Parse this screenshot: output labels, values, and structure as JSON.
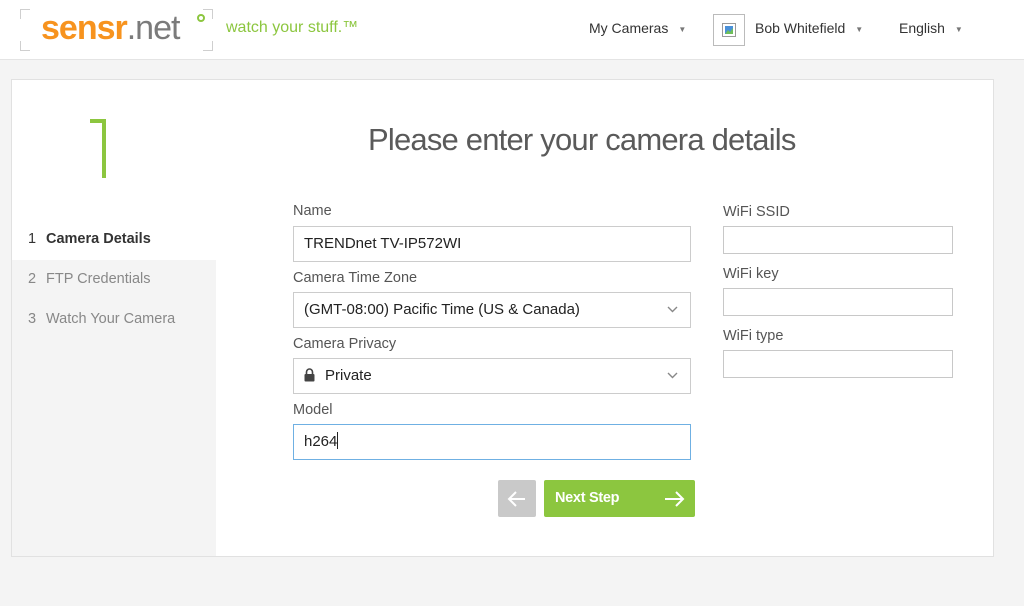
{
  "header": {
    "logo_main": "sensr",
    "logo_suffix": ".net",
    "tagline": "watch your stuff.™",
    "nav": {
      "my_cameras": "My Cameras",
      "user_name": "Bob Whitefield",
      "language": "English"
    }
  },
  "sidebar": {
    "big_step": "1",
    "steps": [
      {
        "num": "1",
        "label": "Camera Details"
      },
      {
        "num": "2",
        "label": "FTP Credentials"
      },
      {
        "num": "3",
        "label": "Watch Your Camera"
      }
    ]
  },
  "form": {
    "title": "Please enter your camera details",
    "name_label": "Name",
    "name_value": "TRENDnet TV-IP572WI",
    "timezone_label": "Camera Time Zone",
    "timezone_value": "(GMT-08:00) Pacific Time (US & Canada)",
    "privacy_label": "Camera Privacy",
    "privacy_value": "Private",
    "model_label": "Model",
    "model_value": "h264",
    "wifi_ssid_label": "WiFi SSID",
    "wifi_ssid_value": "",
    "wifi_key_label": "WiFi key",
    "wifi_key_value": "",
    "wifi_type_label": "WiFi type",
    "wifi_type_value": "",
    "next_label": "Next Step"
  },
  "colors": {
    "brand_orange": "#f7931e",
    "brand_green": "#8cc63f",
    "focus_blue": "#6fb0e3"
  }
}
